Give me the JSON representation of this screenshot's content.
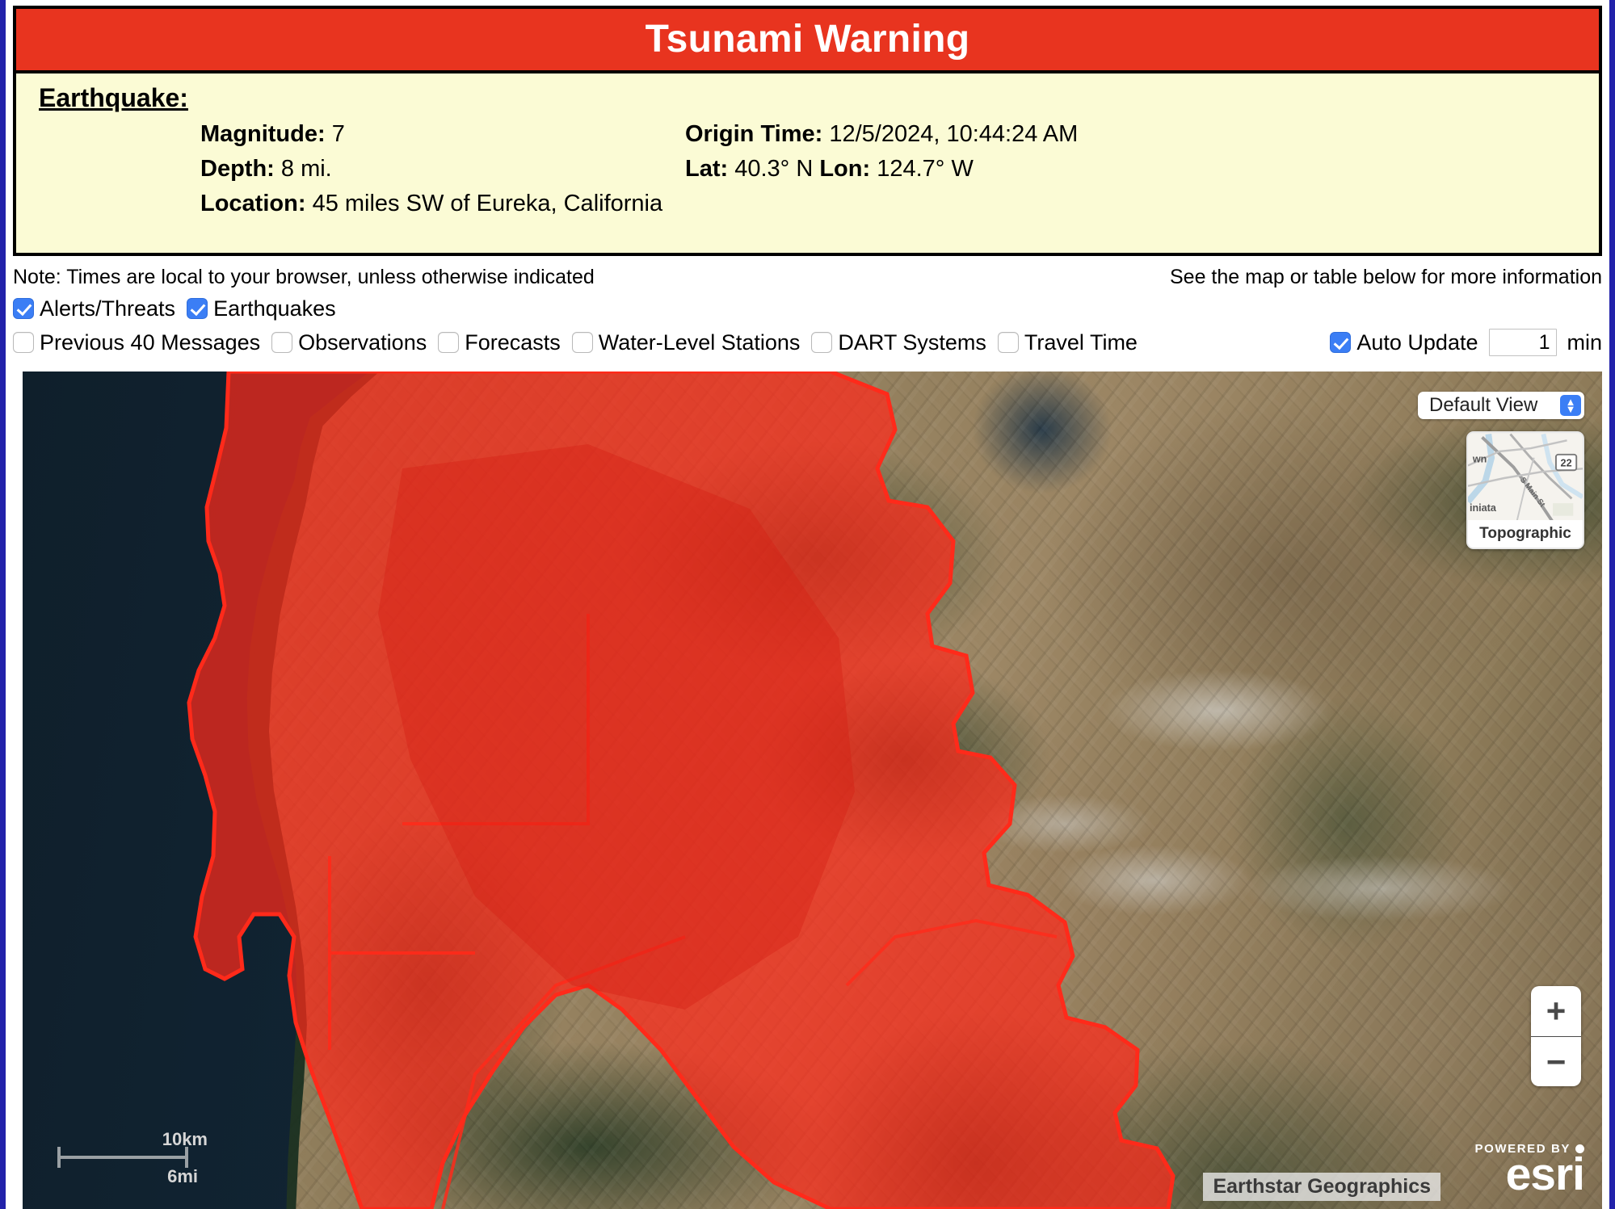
{
  "alert": {
    "title": "Tsunami Warning",
    "section_heading": "Earthquake:",
    "fields": {
      "magnitude_label": "Magnitude:",
      "magnitude_value": "7",
      "origin_time_label": "Origin Time:",
      "origin_time_value": "12/5/2024, 10:44:24 AM",
      "depth_label": "Depth:",
      "depth_value": "8 mi.",
      "lat_label": "Lat:",
      "lat_value": "40.3° N",
      "lon_label": "Lon:",
      "lon_value": "124.7° W",
      "location_label": "Location:",
      "location_value": "45 miles SW of Eureka, California"
    },
    "banner_color": "#e8341f",
    "panel_color": "#fbfbd5"
  },
  "notes": {
    "left": "Note: Times are local to your browser, unless otherwise indicated",
    "right": "See the map or table below for more information"
  },
  "layers": {
    "row1": [
      {
        "label": "Alerts/Threats",
        "checked": true
      },
      {
        "label": "Earthquakes",
        "checked": true
      }
    ],
    "row2": [
      {
        "label": "Previous 40 Messages",
        "checked": false
      },
      {
        "label": "Observations",
        "checked": false
      },
      {
        "label": "Forecasts",
        "checked": false
      },
      {
        "label": "Water-Level Stations",
        "checked": false
      },
      {
        "label": "DART Systems",
        "checked": false
      },
      {
        "label": "Travel Time",
        "checked": false
      }
    ],
    "auto_update": {
      "label": "Auto Update",
      "checked": true,
      "interval_value": "1",
      "interval_unit": "min"
    },
    "checkbox_accent": "#3b7ef5"
  },
  "map": {
    "view_select_value": "Default View",
    "basemap_thumb_label": "Topographic",
    "basemap_thumb_text": {
      "street": "S Main St",
      "place_left": "wn",
      "place_bottom": "iniata",
      "route_shield": "22"
    },
    "zoom_in_label": "+",
    "zoom_out_label": "−",
    "scale": {
      "metric": "10km",
      "imperial": "6mi"
    },
    "attribution": "Earthstar Geographics",
    "esri": {
      "powered_by": "POWERED BY",
      "wordmark": "esri"
    },
    "warning_overlay_color": "#ff2a1a",
    "ocean_color": "#13293a"
  }
}
